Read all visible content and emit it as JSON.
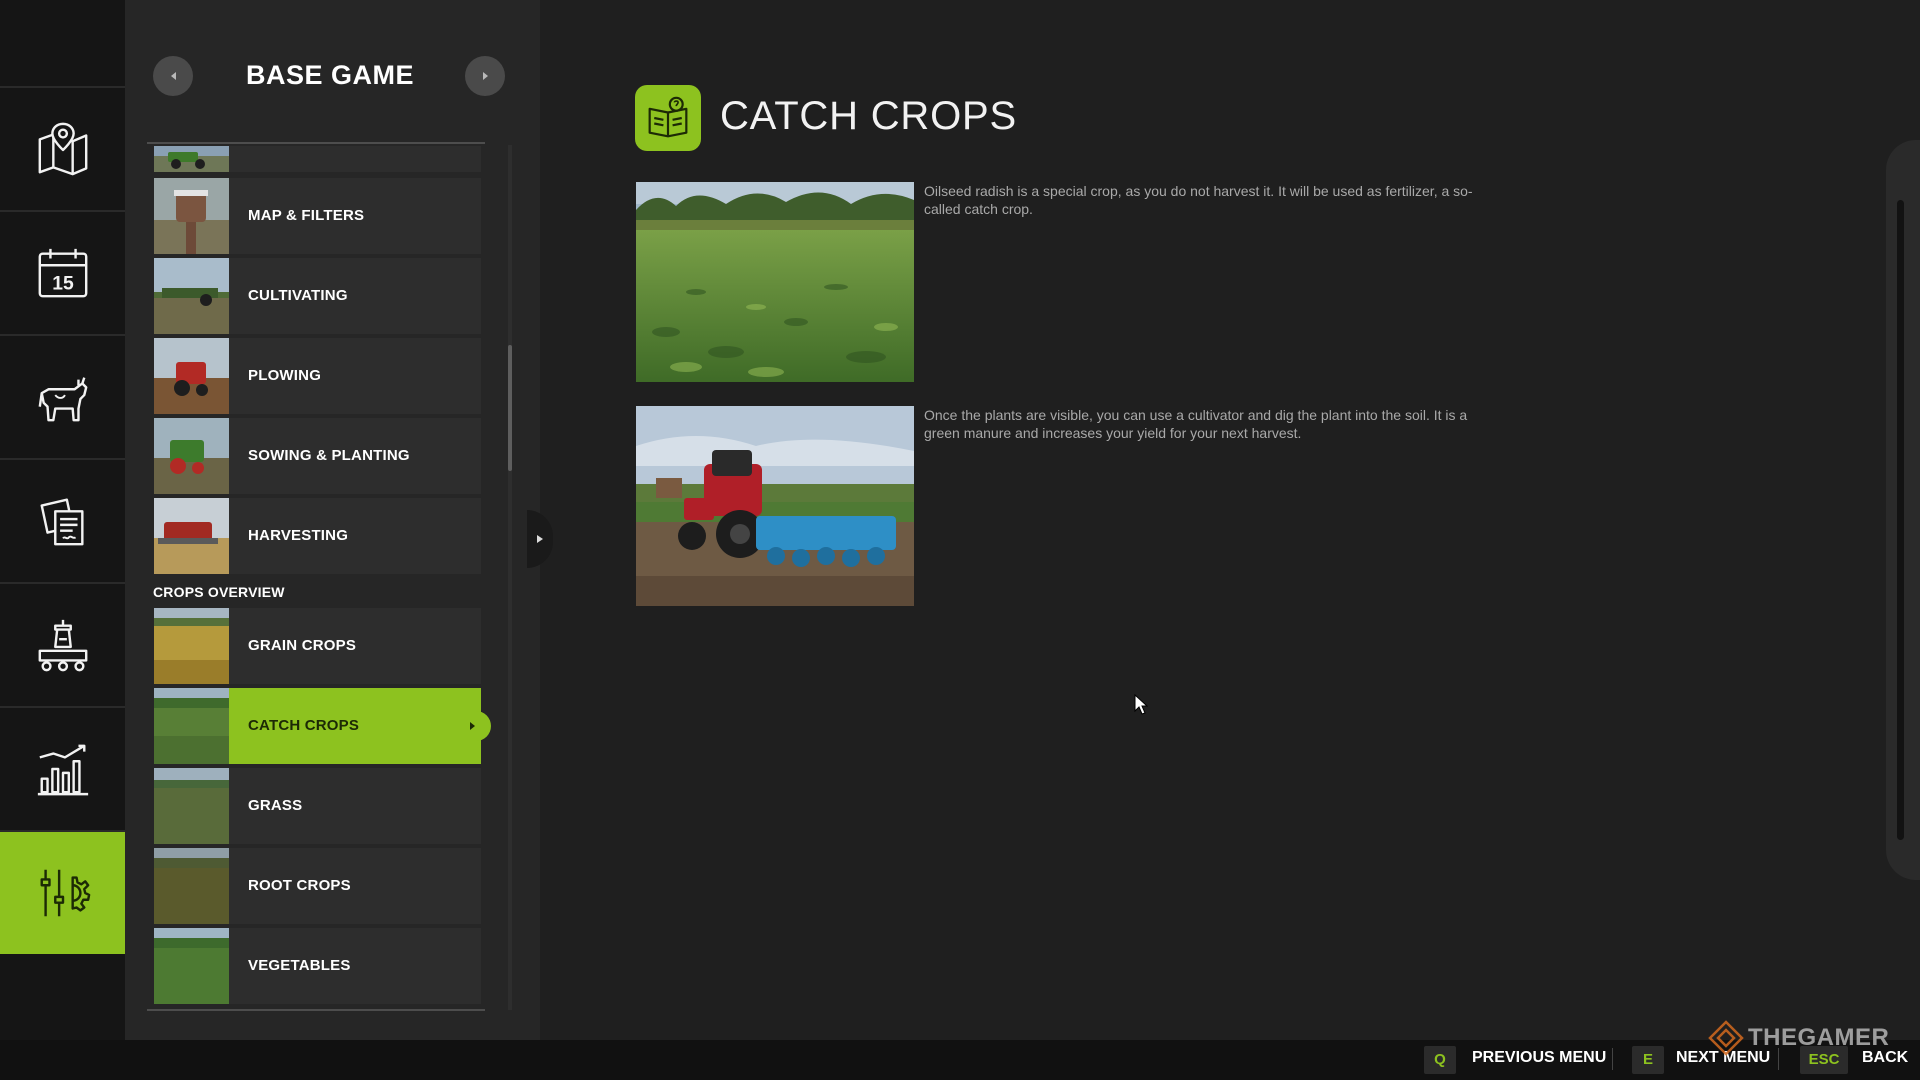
{
  "rail": {
    "items": [
      {
        "name": "map",
        "icon": "map-icon"
      },
      {
        "name": "calendar",
        "icon": "calendar-icon",
        "day": "15"
      },
      {
        "name": "animals",
        "icon": "cow-icon"
      },
      {
        "name": "contracts",
        "icon": "contracts-icon"
      },
      {
        "name": "production",
        "icon": "production-icon"
      },
      {
        "name": "statistics",
        "icon": "statistics-icon"
      },
      {
        "name": "settings",
        "icon": "settings-sliders-icon",
        "active": true
      }
    ],
    "accent": "#8dc21f"
  },
  "menu": {
    "title": "BASE GAME",
    "items": [
      {
        "label": "MAP & FILTERS"
      },
      {
        "label": "CULTIVATING"
      },
      {
        "label": "PLOWING"
      },
      {
        "label": "SOWING & PLANTING"
      },
      {
        "label": "HARVESTING"
      }
    ],
    "section_crops": "CROPS OVERVIEW",
    "crops": [
      {
        "label": "GRAIN CROPS"
      },
      {
        "label": "CATCH CROPS",
        "selected": true
      },
      {
        "label": "GRASS"
      },
      {
        "label": "ROOT CROPS"
      },
      {
        "label": "VEGETABLES"
      }
    ]
  },
  "content": {
    "title": "CATCH CROPS",
    "icon": "help-book-icon",
    "blocks": [
      {
        "image": "oilseed-radish-field-image",
        "text": "Oilseed radish is a special crop, as you do not harvest it. It will be used as fertilizer, a so-called catch crop."
      },
      {
        "image": "tractor-cultivator-image",
        "text": "Once the plants are visible, you can use a cultivator and dig the plant into the soil. It is a green manure and increases your yield for your next harvest."
      }
    ]
  },
  "footer": {
    "prev_key": "Q",
    "prev_label": "PREVIOUS MENU",
    "next_key": "E",
    "next_label": "NEXT MENU",
    "back_key": "ESC",
    "back_label": "BACK"
  },
  "watermark": "THEGAMER"
}
